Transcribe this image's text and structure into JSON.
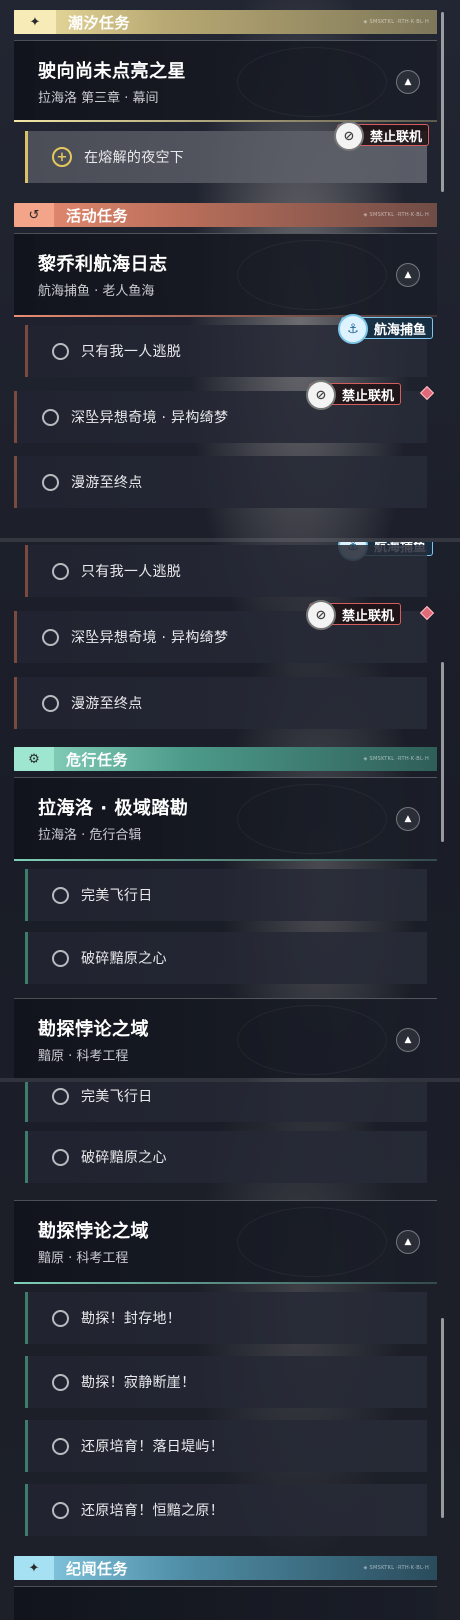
{
  "header_deco": "◈ SMSKTKL ·RTH·K·BL·H",
  "sections": {
    "tide": {
      "label": "潮汐任务",
      "icon": "sparkle-icon"
    },
    "event": {
      "label": "活动任务",
      "icon": "return-arrow-icon"
    },
    "danger": {
      "label": "危行任务",
      "icon": "eye-gear-icon"
    },
    "lore": {
      "label": "纪闻任务",
      "icon": "sparkle-icon"
    }
  },
  "missions": {
    "tide": {
      "title": "驶向尚未点亮之星",
      "subtitle": "拉海洛 第三章 · 幕间"
    },
    "event": {
      "title": "黎乔利航海日志",
      "subtitle": "航海捕鱼 · 老人鱼海"
    },
    "danger1": {
      "title": "拉海洛 · 极域踏勘",
      "subtitle": "拉海洛 · 危行合辑"
    },
    "danger2": {
      "title": "勘探悖论之域",
      "subtitle": "黯原 · 科考工程"
    }
  },
  "subtasks": {
    "molten": "在熔解的夜空下",
    "alone": "只有我一人逃脱",
    "deep": "深坠异想奇境 · 异构绮梦",
    "roam": "漫游至终点",
    "flight": "完美飞行日",
    "broken": "破碎黯原之心",
    "explore1": "勘探！封存地！",
    "explore2": "勘探！寂静断崖！",
    "restore1": "还原培育！落日堤屿！",
    "restore2": "还原培育！恒黯之原！"
  },
  "tags": {
    "no_coop": "禁止联机",
    "fishing": "航海捕鱼"
  },
  "arrow_glyph": "▲",
  "star_glyph": "+",
  "colors": {
    "tide_accent": "#f1e3a4",
    "event_accent": "#e98d72",
    "danger_accent": "#8ed9c2",
    "lore_accent": "#8ccfe8",
    "no_coop_border": "#d45d5d",
    "fishing_border": "#7ec6ea"
  }
}
